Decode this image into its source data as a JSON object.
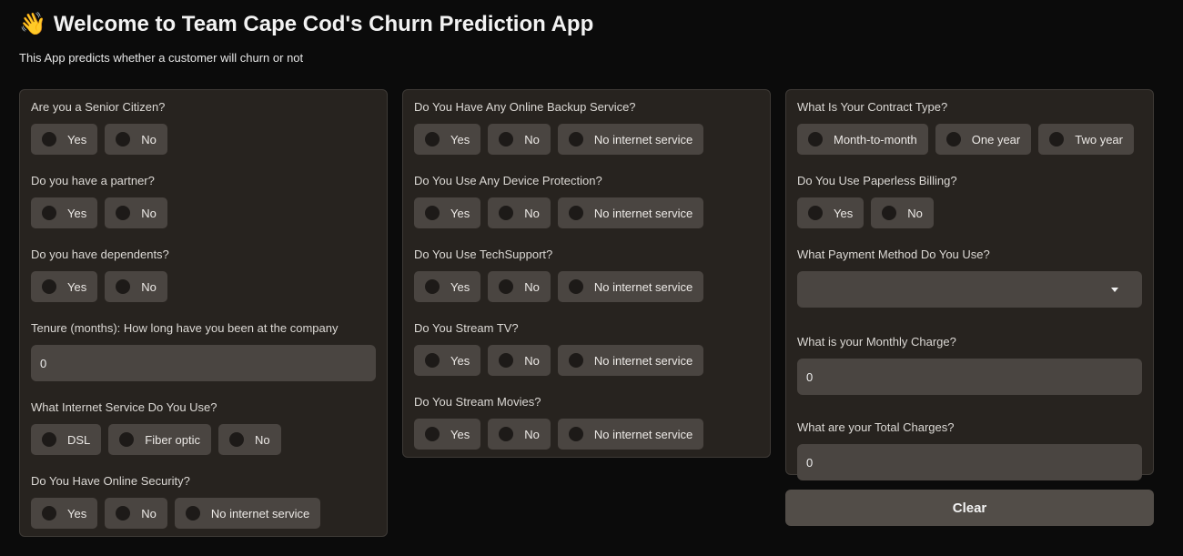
{
  "header": {
    "emoji": "👋",
    "title": "Welcome to Team Cape Cod's Churn Prediction App",
    "subtitle": "This App predicts whether a customer will churn or not"
  },
  "col1": {
    "senior": {
      "label": "Are you a Senior Citizen?",
      "options": [
        "Yes",
        "No"
      ]
    },
    "partner": {
      "label": "Do you have a partner?",
      "options": [
        "Yes",
        "No"
      ]
    },
    "dependents": {
      "label": "Do you have dependents?",
      "options": [
        "Yes",
        "No"
      ]
    },
    "tenure": {
      "label": "Tenure (months): How long have you been at the company",
      "value": "0"
    },
    "internet": {
      "label": "What Internet Service Do You Use?",
      "options": [
        "DSL",
        "Fiber optic",
        "No"
      ]
    },
    "security": {
      "label": "Do You Have Online Security?",
      "options": [
        "Yes",
        "No",
        "No internet service"
      ]
    }
  },
  "col2": {
    "backup": {
      "label": "Do You Have Any Online Backup Service?",
      "options": [
        "Yes",
        "No",
        "No internet service"
      ]
    },
    "protection": {
      "label": "Do You Use Any Device Protection?",
      "options": [
        "Yes",
        "No",
        "No internet service"
      ]
    },
    "techsupport": {
      "label": "Do You Use TechSupport?",
      "options": [
        "Yes",
        "No",
        "No internet service"
      ]
    },
    "tv": {
      "label": "Do You Stream TV?",
      "options": [
        "Yes",
        "No",
        "No internet service"
      ]
    },
    "movies": {
      "label": "Do You Stream Movies?",
      "options": [
        "Yes",
        "No",
        "No internet service"
      ]
    }
  },
  "col3": {
    "contract": {
      "label": "What Is Your Contract Type?",
      "options": [
        "Month-to-month",
        "One year",
        "Two year"
      ]
    },
    "paperless": {
      "label": "Do You Use Paperless Billing?",
      "options": [
        "Yes",
        "No"
      ]
    },
    "payment": {
      "label": "What Payment Method Do You Use?",
      "value": ""
    },
    "monthly": {
      "label": "What is your Monthly Charge?",
      "value": "0"
    },
    "total": {
      "label": "What are your Total Charges?",
      "value": "0"
    }
  },
  "actions": {
    "clear_label": "Clear"
  },
  "colors": {
    "background": "#0b0b0b",
    "panel": "#27231f",
    "control": "#4a4541",
    "button": "#524d48"
  }
}
